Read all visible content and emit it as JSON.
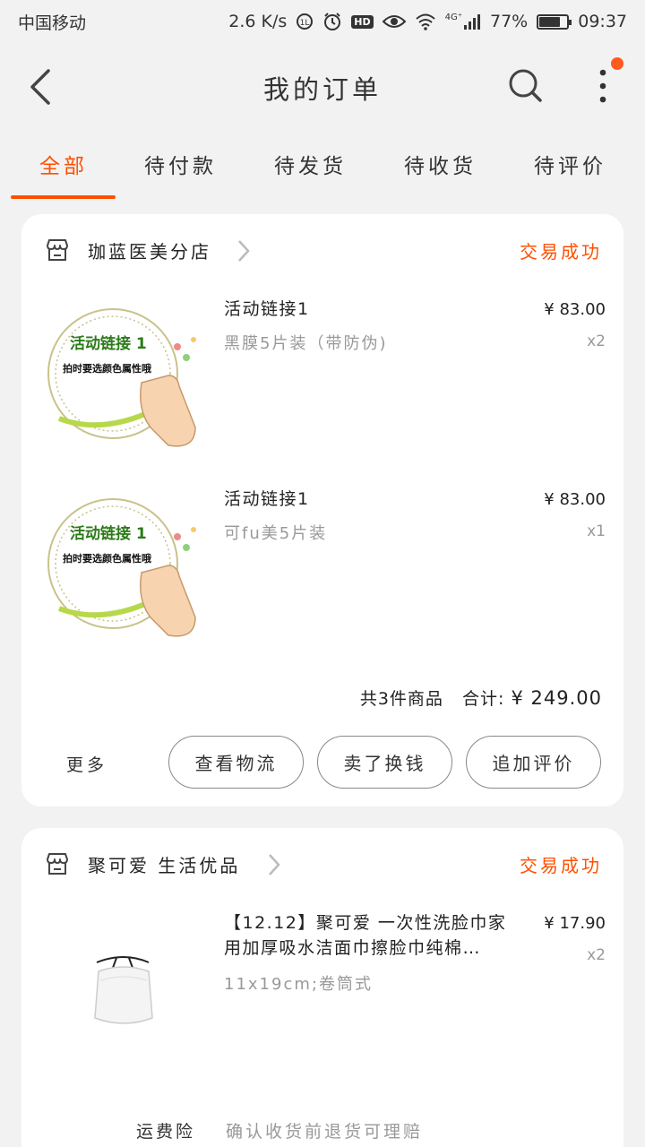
{
  "status_bar": {
    "carrier": "中国移动",
    "speed": "2.6 K/s",
    "hd": "HD",
    "network": "4G⁺",
    "battery": "77%",
    "battery_level": 0.77,
    "time": "09:37"
  },
  "header": {
    "title": "我的订单"
  },
  "tabs": [
    {
      "label": "全部",
      "active": true
    },
    {
      "label": "待付款",
      "active": false
    },
    {
      "label": "待发货",
      "active": false
    },
    {
      "label": "待收货",
      "active": false
    },
    {
      "label": "待评价",
      "active": false
    }
  ],
  "orders": [
    {
      "shop": "珈蓝医美分店",
      "status": "交易成功",
      "items": [
        {
          "title": "活动链接1",
          "sku": "黑膜5片装（带防伪)",
          "price": "¥ 83.00",
          "qty": "x2",
          "thumb_line1": "活动链接 1",
          "thumb_line2": "拍时要选颜色属性哦"
        },
        {
          "title": "活动链接1",
          "sku": "可fu美5片装",
          "price": "¥ 83.00",
          "qty": "x1",
          "thumb_line1": "活动链接 1",
          "thumb_line2": "拍时要选颜色属性哦"
        }
      ],
      "summary_count": "共3件商品",
      "summary_total_label": "合计:",
      "summary_total": "¥ 249.00",
      "more": "更多",
      "buttons": [
        "查看物流",
        "卖了换钱",
        "追加评价"
      ]
    },
    {
      "shop": "聚可爱 生活优品",
      "status": "交易成功",
      "items": [
        {
          "title_line1": "【12.12】聚可爱 一次性洗脸巾家",
          "title_line2": "用加厚吸水洁面巾擦脸巾纯棉…",
          "sku": "11x19cm;卷筒式",
          "price": "¥ 17.90",
          "qty": "x2"
        }
      ],
      "insurance_label": "运费险",
      "insurance_text": "确认收货前退货可理赔"
    }
  ],
  "colors": {
    "accent": "#ff5000",
    "background": "#f2f2f2",
    "card": "#ffffff",
    "promo_green": "#2d7a1a"
  }
}
